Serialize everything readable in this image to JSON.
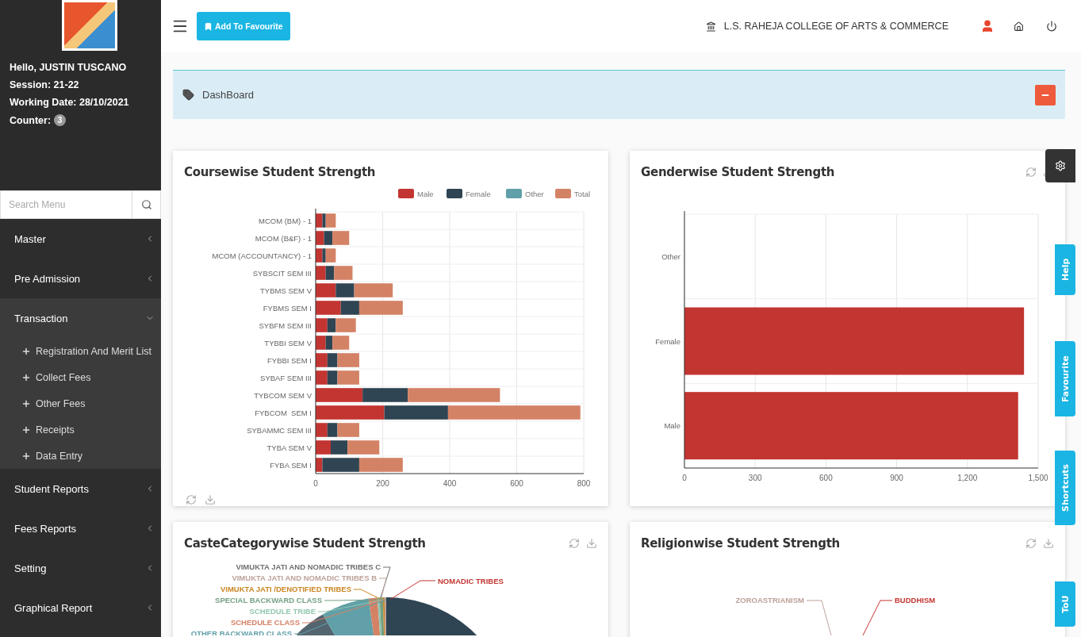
{
  "sidebar": {
    "greeting": "Hello, JUSTIN TUSCANO",
    "session": "Session: 21-22",
    "working_date": "Working Date: 28/10/2021",
    "counter_label": "Counter:",
    "counter": "3",
    "search": {
      "placeholder": "Search Menu"
    },
    "menu": [
      {
        "label": "Master",
        "expanded": false
      },
      {
        "label": "Pre Admission",
        "expanded": false
      },
      {
        "label": "Transaction",
        "expanded": true,
        "children": [
          "Registration And Merit List",
          "Collect Fees",
          "Other Fees",
          "Receipts",
          "Data Entry"
        ]
      },
      {
        "label": "Student Reports",
        "expanded": false
      },
      {
        "label": "Fees Reports",
        "expanded": false
      },
      {
        "label": "Setting",
        "expanded": false
      },
      {
        "label": "Graphical Report",
        "expanded": false
      }
    ]
  },
  "header": {
    "favourite_button": "Add To Favourite",
    "college": "L.S. RAHEJA COLLEGE OF ARTS & COMMERCE"
  },
  "breadcrumb": "DashBoard",
  "cards": [
    {
      "title": "Coursewise Student Strength",
      "kind": "bar",
      "chart_data": {
        "type": "bar",
        "orientation": "horizontal",
        "stacked": true,
        "categories": [
          "MCOM (BM) - 1",
          "MCOM (B&F) - 1",
          "MCOM (ACCOUNTANCY) - 1",
          "SYBSCIT SEM III",
          "TYBMS SEM V",
          "FYBMS SEM I",
          "SYBFM SEM III",
          "TYBBI SEM V",
          "FYBBI SEM I",
          "SYBAF SEM III",
          "TYBCOM SEM V",
          "FYBCOM  SEM I",
          "SYBAMMC SEM III",
          "TYBA SEM V",
          "FYBA SEM I"
        ],
        "series": [
          {
            "name": "Male",
            "color": "#c23531",
            "values": [
              20,
              25,
              20,
              30,
              60,
              75,
              35,
              30,
              35,
              35,
              140,
              205,
              35,
              45,
              20
            ]
          },
          {
            "name": "Female",
            "color": "#2f4554",
            "values": [
              10,
              25,
              10,
              25,
              55,
              55,
              25,
              20,
              30,
              30,
              135,
              190,
              30,
              50,
              110
            ]
          },
          {
            "name": "Other",
            "color": "#61a0a8",
            "values": [
              0,
              0,
              0,
              0,
              0,
              0,
              0,
              0,
              0,
              0,
              0,
              0,
              0,
              0,
              0
            ]
          },
          {
            "name": "Total",
            "color": "#d48265",
            "values": [
              30,
              50,
              30,
              55,
              115,
              130,
              60,
              50,
              65,
              65,
              275,
              395,
              65,
              95,
              130
            ]
          }
        ],
        "xlim": [
          0,
          800
        ],
        "xticks": [
          0,
          200,
          400,
          600,
          800
        ],
        "grid": true,
        "legend": true
      }
    },
    {
      "title": "Genderwise Student Strength",
      "kind": "bar",
      "chart_data": {
        "type": "bar",
        "orientation": "horizontal",
        "categories": [
          "Other",
          "Female",
          "Male"
        ],
        "series": [
          {
            "color": "#c23531",
            "values": [
              0,
              1440,
              1415
            ]
          }
        ],
        "xlim": [
          0,
          1500
        ],
        "xticks": [
          0,
          300,
          600,
          900,
          {
            "value": 1200,
            "label": "1,200"
          },
          {
            "value": 1500,
            "label": "1,500"
          }
        ],
        "grid": true
      }
    },
    {
      "title": "CasteCategorywise Student Strength",
      "kind": "pie",
      "left_labels": [
        {
          "text": "VIMUKTA JATI AND NOMADIC TRIBES C",
          "color": "#6e7074"
        },
        {
          "text": "VIMUKTA JATI AND NOMADIC TRIBES B",
          "color": "#bda29a"
        },
        {
          "text": "VIMUKTA JATI /DENOTIFIED TRIBES",
          "color": "#ca8622"
        },
        {
          "text": "SPECIAL BACKWARD CLASS",
          "color": "#749f83"
        },
        {
          "text": "SCHEDULE TRIBE",
          "color": "#91c7ae"
        },
        {
          "text": "SCHEDULE CLASS",
          "color": "#d48265"
        },
        {
          "text": "OTHER BACKWARD CLASS",
          "color": "#61a0a8"
        }
      ],
      "right_labels": [
        {
          "text": "NOMADIC TRIBES",
          "color": "#c23531"
        }
      ]
    },
    {
      "title": "Religionwise Student Strength",
      "kind": "pie",
      "left_labels": [
        {
          "text": "ZOROASTRIANISM",
          "color": "#bda29a"
        }
      ],
      "right_labels": [
        {
          "text": "BUDDHISM",
          "color": "#c23531"
        }
      ]
    }
  ],
  "side_tabs": [
    "Help",
    "Favourite",
    "Shortcuts",
    "ToU"
  ]
}
